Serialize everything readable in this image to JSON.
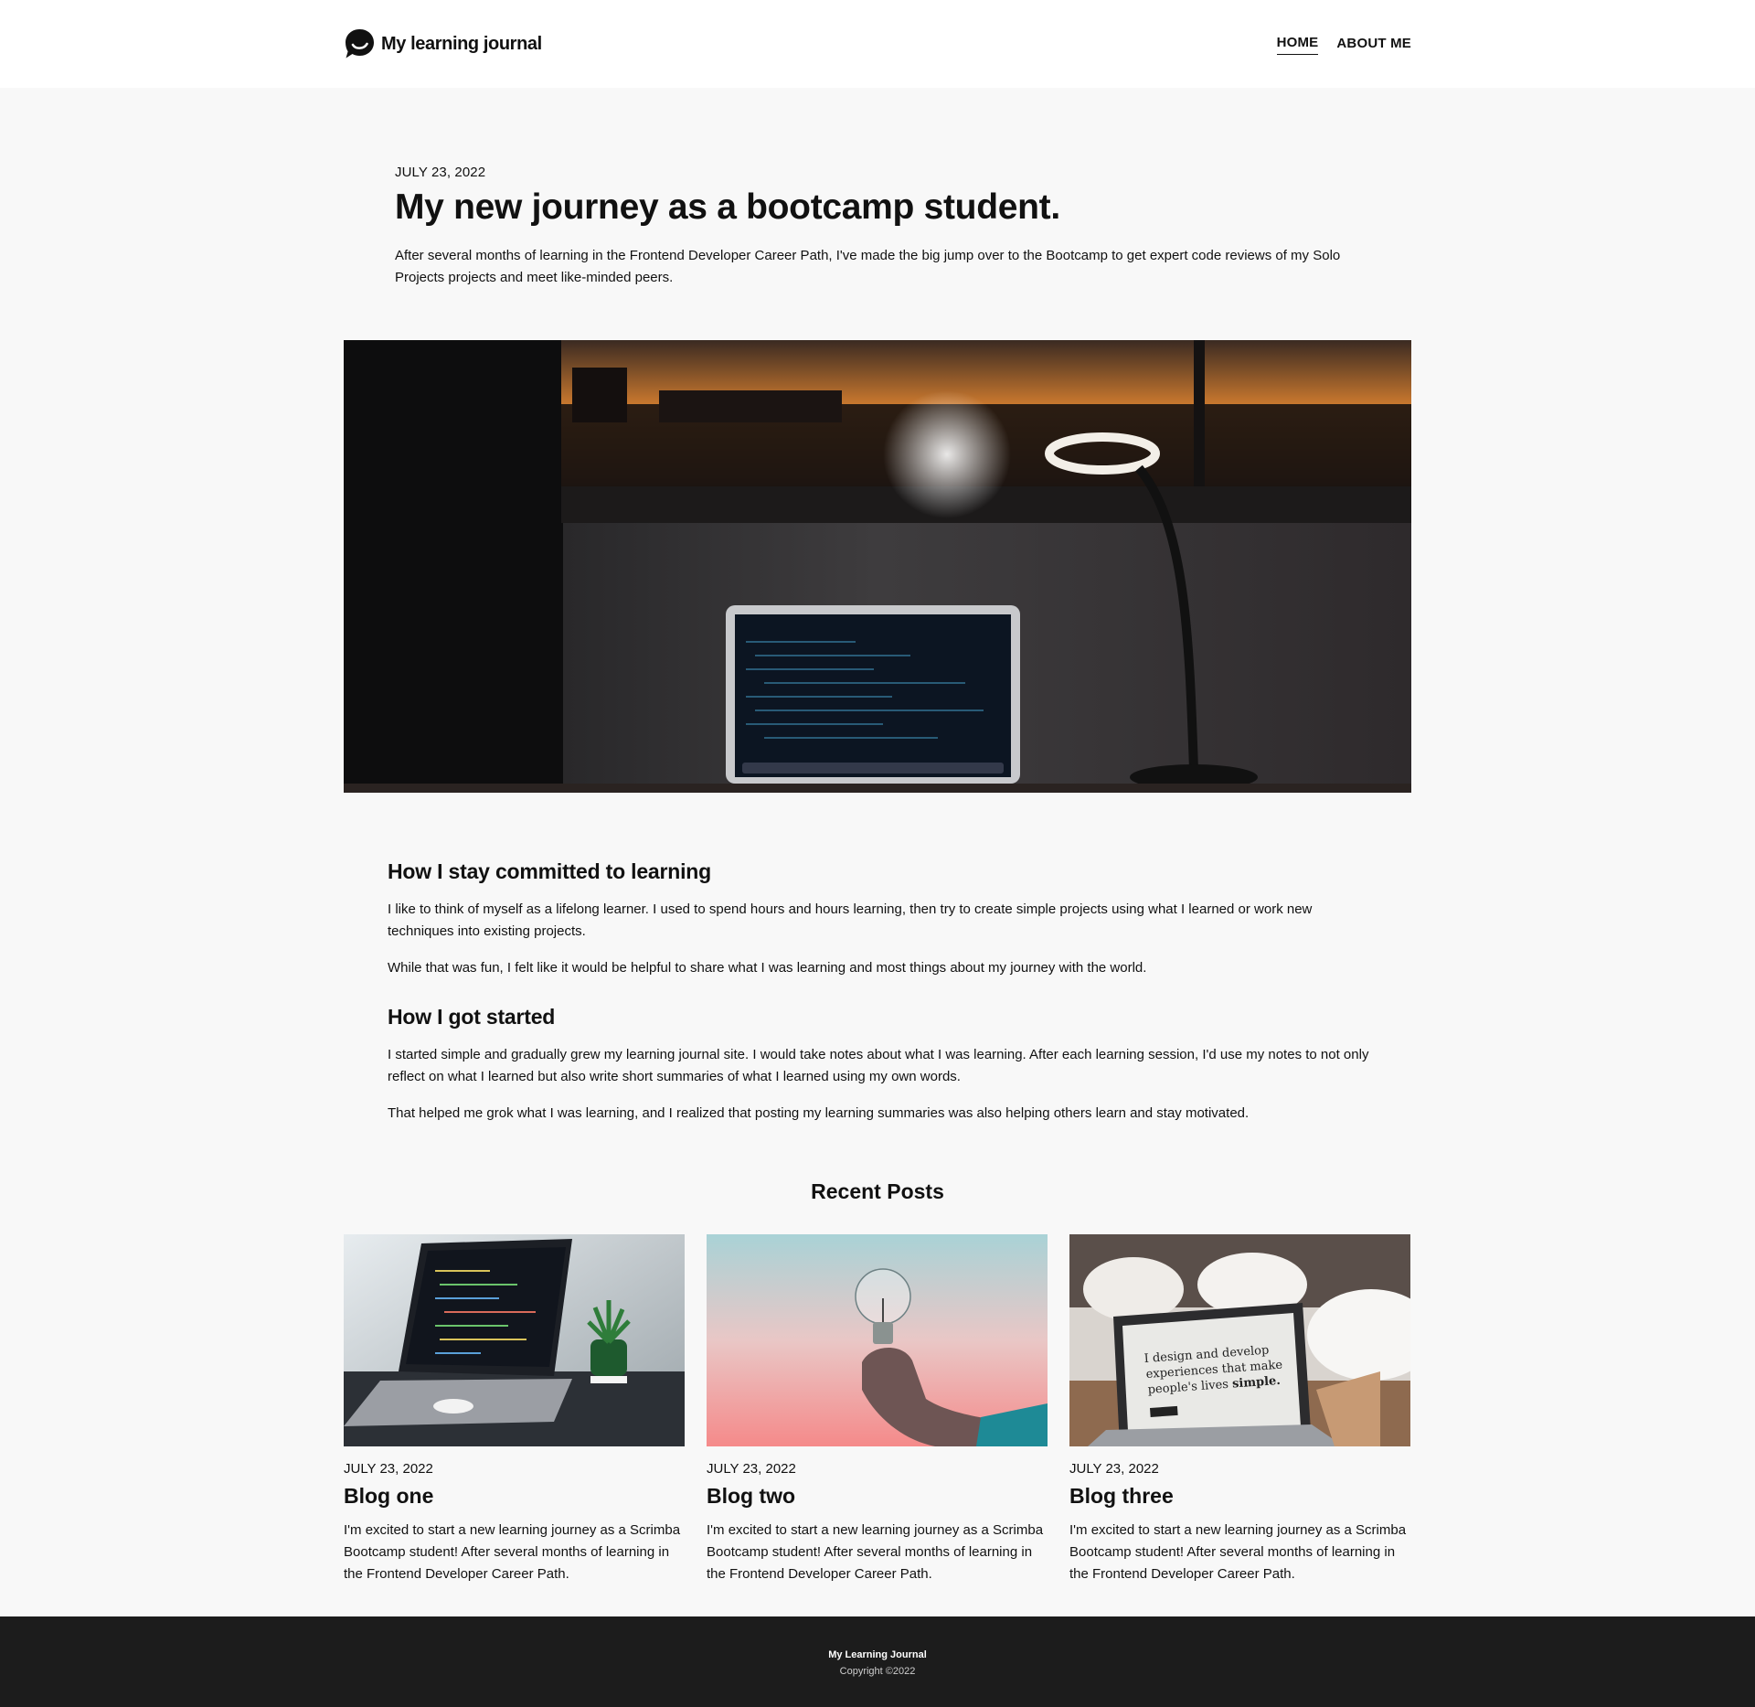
{
  "header": {
    "brand_name": "My learning journal",
    "logo_icon": "speech-bubble-smile-icon",
    "nav": [
      {
        "label": "HOME",
        "active": true
      },
      {
        "label": "ABOUT ME",
        "active": false
      }
    ]
  },
  "hero": {
    "date": "JULY 23, 2022",
    "title": "My new journey as a bootcamp student.",
    "description": "After several months of learning in the Frontend Developer Career Path, I've made the big jump over to the Bootcamp to get expert code reviews of my Solo Projects projects and meet like-minded peers.",
    "image_subject": "laptop-on-desk-at-sunset-with-lamp"
  },
  "article": {
    "sections": [
      {
        "heading": "How I stay committed to learning",
        "paragraphs": [
          "I like to think of myself as a lifelong learner. I used to spend hours and hours learning, then try to create simple projects using what I learned or work new techniques into existing projects.",
          "While that was fun, I felt like it would be helpful to share what I was learning and most things about my journey with the world."
        ]
      },
      {
        "heading": "How I got started",
        "paragraphs": [
          "I started simple and gradually grew my learning journal site. I would take notes about what I was learning. After each learning session, I'd use my notes to not only reflect on what I learned but also write short summaries of what I learned using my own words.",
          "That helped me grok what I was learning, and I realized that posting my learning summaries was also helping others learn and stay motivated."
        ]
      }
    ]
  },
  "recent": {
    "title": "Recent Posts",
    "posts": [
      {
        "date": "JULY 23, 2022",
        "title": "Blog one",
        "excerpt": "I'm excited to start a new learning journey as a Scrimba Bootcamp student! After several months of learning in the Frontend Developer Career Path.",
        "image_subject": "laptop-with-code-and-plant"
      },
      {
        "date": "JULY 23, 2022",
        "title": "Blog two",
        "excerpt": "I'm excited to start a new learning journey as a Scrimba Bootcamp student! After several months of learning in the Frontend Developer Career Path.",
        "image_subject": "hand-holding-light-bulb"
      },
      {
        "date": "JULY 23, 2022",
        "title": "Blog three",
        "excerpt": "I'm excited to start a new learning journey as a Scrimba Bootcamp student! After several months of learning in the Frontend Developer Career Path.",
        "image_subject": "laptop-design-website"
      }
    ],
    "blog_three_screen": {
      "line1": "I design and develop",
      "line2": "experiences that make",
      "line3_start": "people's lives ",
      "line3_bold": "simple."
    }
  },
  "footer": {
    "name": "My Learning Journal",
    "copyright": "Copyright ©2022"
  },
  "colors": {
    "page_bg": "#f8f8f8",
    "header_bg": "#ffffff",
    "footer_bg": "#1c1c1c",
    "text": "#111111"
  }
}
